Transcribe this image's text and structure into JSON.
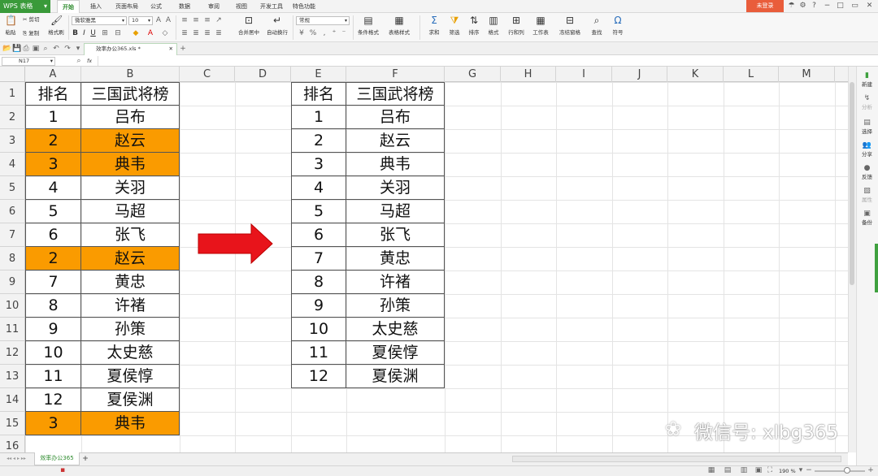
{
  "app": {
    "name": "WPS 表格",
    "login": "未登录"
  },
  "menu_tabs": [
    "开始",
    "插入",
    "页面布局",
    "公式",
    "数据",
    "审阅",
    "视图",
    "开发工具",
    "特色功能"
  ],
  "toolbar": {
    "paste": "粘贴",
    "cut": "剪切",
    "copy": "复制",
    "format_painter": "格式刷",
    "font_name": "微软雅黑",
    "font_size": "10",
    "merge_center": "合并居中",
    "wrap_text": "自动换行",
    "number_format": "常规",
    "conditional_format": "条件格式",
    "table_style": "表格样式",
    "sum": "求和",
    "filter": "筛选",
    "sort": "排序",
    "format": "格式",
    "row_col": "行和列",
    "worksheet": "工作表",
    "freeze": "冻结窗格",
    "find": "查找",
    "symbol": "符号"
  },
  "doc_tab": "效率办公365.xls *",
  "formula_bar": {
    "name_box": "N17",
    "fx": "fx",
    "formula": ""
  },
  "columns": [
    "A",
    "B",
    "C",
    "D",
    "E",
    "F",
    "G",
    "H",
    "I",
    "J",
    "K",
    "L",
    "M"
  ],
  "rows": [
    "1",
    "2",
    "3",
    "4",
    "5",
    "6",
    "7",
    "8",
    "9",
    "10",
    "11",
    "12",
    "13",
    "14",
    "15",
    "16"
  ],
  "left_table": {
    "header": [
      "排名",
      "三国武将榜"
    ],
    "rows": [
      [
        "1",
        "吕布"
      ],
      [
        "2",
        "赵云"
      ],
      [
        "3",
        "典韦"
      ],
      [
        "4",
        "关羽"
      ],
      [
        "5",
        "马超"
      ],
      [
        "6",
        "张飞"
      ],
      [
        "2",
        "赵云"
      ],
      [
        "7",
        "黄忠"
      ],
      [
        "8",
        "许褚"
      ],
      [
        "9",
        "孙策"
      ],
      [
        "10",
        "太史慈"
      ],
      [
        "11",
        "夏侯惇"
      ],
      [
        "12",
        "夏侯渊"
      ],
      [
        "3",
        "典韦"
      ]
    ],
    "highlighted_rows": [
      1,
      2,
      6,
      13
    ],
    "highlight_color": "#FA9B00"
  },
  "right_table": {
    "header": [
      "排名",
      "三国武将榜"
    ],
    "rows": [
      [
        "1",
        "吕布"
      ],
      [
        "2",
        "赵云"
      ],
      [
        "3",
        "典韦"
      ],
      [
        "4",
        "关羽"
      ],
      [
        "5",
        "马超"
      ],
      [
        "6",
        "张飞"
      ],
      [
        "7",
        "黄忠"
      ],
      [
        "8",
        "许褚"
      ],
      [
        "9",
        "孙策"
      ],
      [
        "10",
        "太史慈"
      ],
      [
        "11",
        "夏侯惇"
      ],
      [
        "12",
        "夏侯渊"
      ]
    ]
  },
  "arrow": {
    "color": "#E8141B",
    "direction": "right"
  },
  "watermark": "微信号: xlbg365",
  "side_panel": [
    "新建",
    "分析",
    "选择",
    "分享",
    "反馈",
    "属性",
    "备份"
  ],
  "sheet_tab": "效率办公365",
  "status": {
    "zoom": "190 %"
  }
}
